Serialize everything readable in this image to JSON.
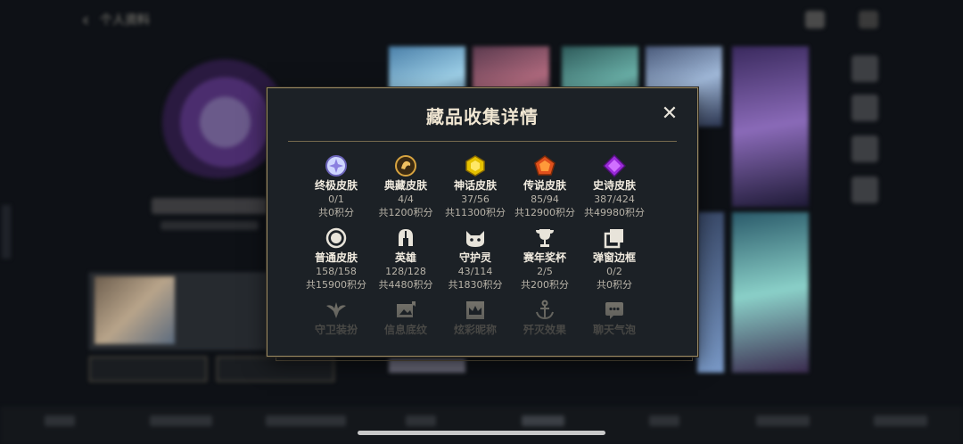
{
  "background": {
    "title": "个人资料",
    "back_glyph": "‹"
  },
  "modal": {
    "title": "藏品收集详情",
    "close_glyph": "✕",
    "rows": [
      [
        {
          "label": "终极皮肤",
          "count": "0/1",
          "points": "共0积分",
          "icon": "ultimate-gem-icon"
        },
        {
          "label": "典藏皮肤",
          "count": "4/4",
          "points": "共1200积分",
          "icon": "prestige-gem-icon"
        },
        {
          "label": "神话皮肤",
          "count": "37/56",
          "points": "共11300积分",
          "icon": "mythic-gem-icon"
        },
        {
          "label": "传说皮肤",
          "count": "85/94",
          "points": "共12900积分",
          "icon": "legendary-gem-icon"
        },
        {
          "label": "史诗皮肤",
          "count": "387/424",
          "points": "共49980积分",
          "icon": "epic-gem-icon"
        }
      ],
      [
        {
          "label": "普通皮肤",
          "count": "158/158",
          "points": "共15900积分",
          "icon": "standard-skin-icon"
        },
        {
          "label": "英雄",
          "count": "128/128",
          "points": "共4480积分",
          "icon": "helmet-icon"
        },
        {
          "label": "守护灵",
          "count": "43/114",
          "points": "共1830积分",
          "icon": "cat-icon"
        },
        {
          "label": "赛年奖杯",
          "count": "2/5",
          "points": "共200积分",
          "icon": "trophy-icon"
        },
        {
          "label": "弹窗边框",
          "count": "0/2",
          "points": "共0积分",
          "icon": "frame-icon"
        }
      ],
      [
        {
          "label": "守卫装扮",
          "icon": "ward-icon"
        },
        {
          "label": "信息底纹",
          "icon": "banner-icon"
        },
        {
          "label": "炫彩昵称",
          "icon": "crown-icon"
        },
        {
          "label": "歼灭效果",
          "icon": "anchor-icon"
        },
        {
          "label": "聊天气泡",
          "icon": "chat-bubble-icon"
        }
      ]
    ]
  },
  "colors": {
    "modal_bg": "#1c2126",
    "gold_border": "#9b8a62",
    "title_text": "#f0e6d2"
  }
}
